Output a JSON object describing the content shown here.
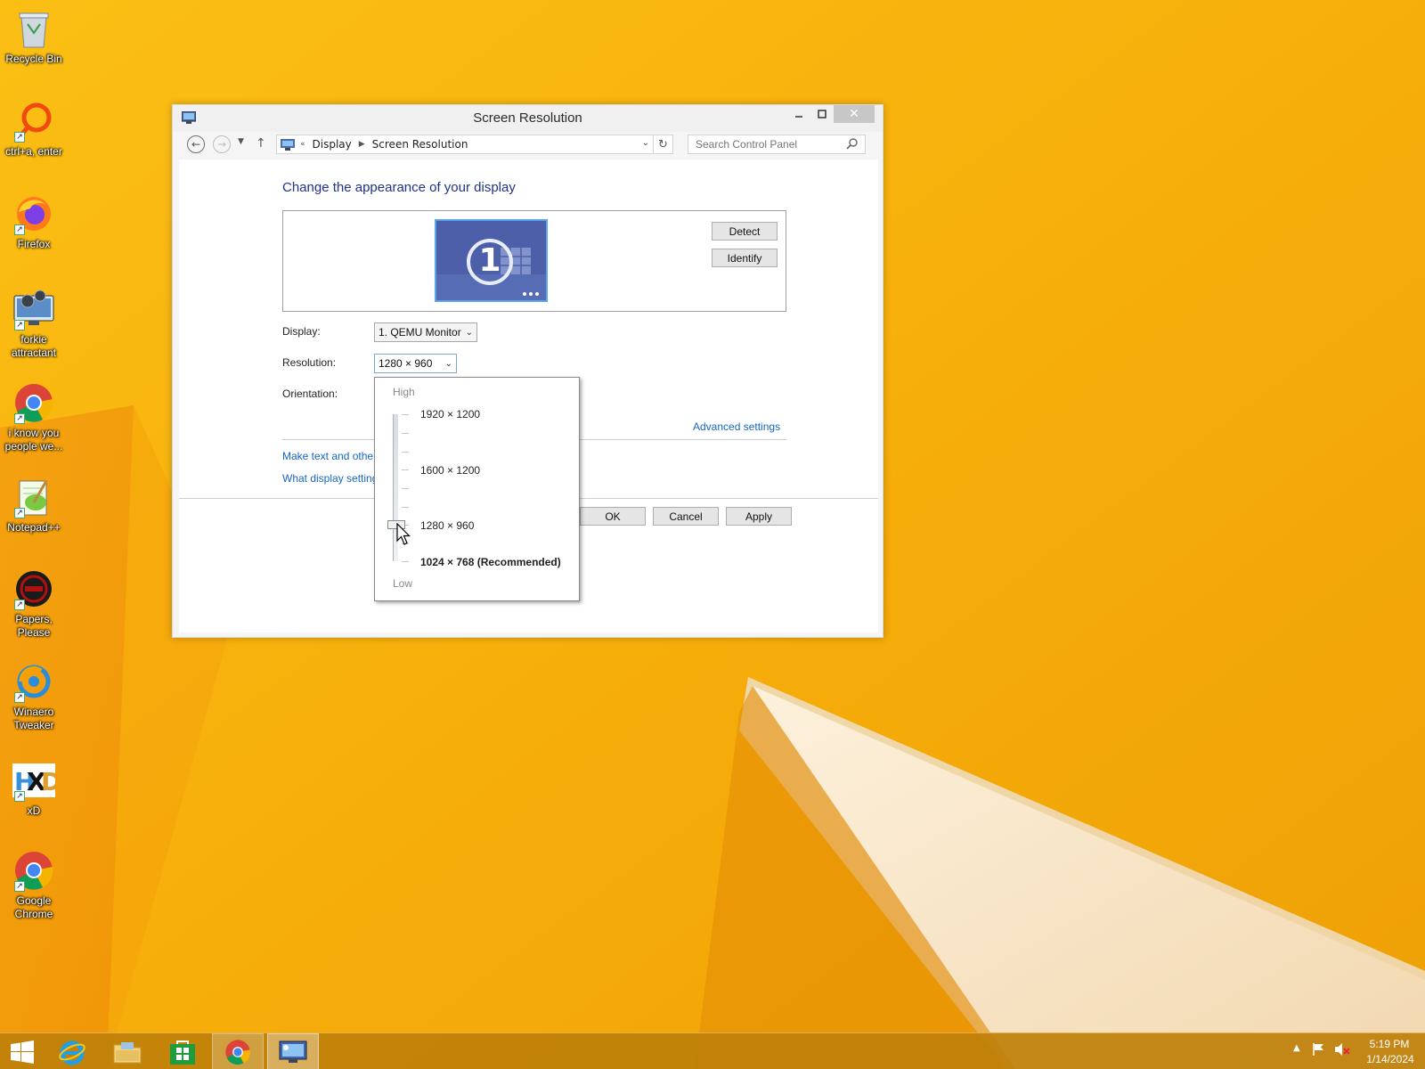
{
  "desktop": {
    "icons": [
      {
        "label": "Recycle Bin"
      },
      {
        "label": "ctrl+a, enter"
      },
      {
        "label": "Firefox"
      },
      {
        "label": "forkie attractant"
      },
      {
        "label": "i know you people we..."
      },
      {
        "label": "Notepad++"
      },
      {
        "label": "Papers, Please"
      },
      {
        "label": "Winaero Tweaker"
      },
      {
        "label": "xD"
      },
      {
        "label": "Google Chrome"
      }
    ]
  },
  "window": {
    "title": "Screen Resolution",
    "close_glyph": "✕",
    "nav": {
      "breadcrumb_prefix": "«",
      "breadcrumb": [
        "Display",
        "Screen Resolution"
      ],
      "search_placeholder": "Search Control Panel"
    },
    "heading": "Change the appearance of your display",
    "monitor_number": "1",
    "buttons": {
      "detect": "Detect",
      "identify": "Identify",
      "ok": "OK",
      "cancel": "Cancel",
      "apply": "Apply"
    },
    "form": {
      "display_label": "Display:",
      "display_value": "1. QEMU Monitor",
      "resolution_label": "Resolution:",
      "resolution_value": "1280 × 960",
      "orientation_label": "Orientation:"
    },
    "links": {
      "advanced": "Advanced settings",
      "text_size": "Make text and other",
      "what_settings": "What display setting"
    }
  },
  "resolution_popup": {
    "high_label": "High",
    "low_label": "Low",
    "options": [
      {
        "label": "1920 × 1200",
        "recommended": false
      },
      {
        "label": "1600 × 1200",
        "recommended": false
      },
      {
        "label": "1280 × 960",
        "recommended": false
      },
      {
        "label": "1024 × 768 (Recommended)",
        "recommended": true
      }
    ],
    "selected": "1280 × 960"
  },
  "taskbar": {
    "clock_time": "5:19 PM",
    "clock_date": "1/14/2024"
  },
  "colors": {
    "wallpaper": "#f7b20c",
    "link": "#1565c0",
    "heading": "#1e3287",
    "taskbar": "#be800a"
  }
}
